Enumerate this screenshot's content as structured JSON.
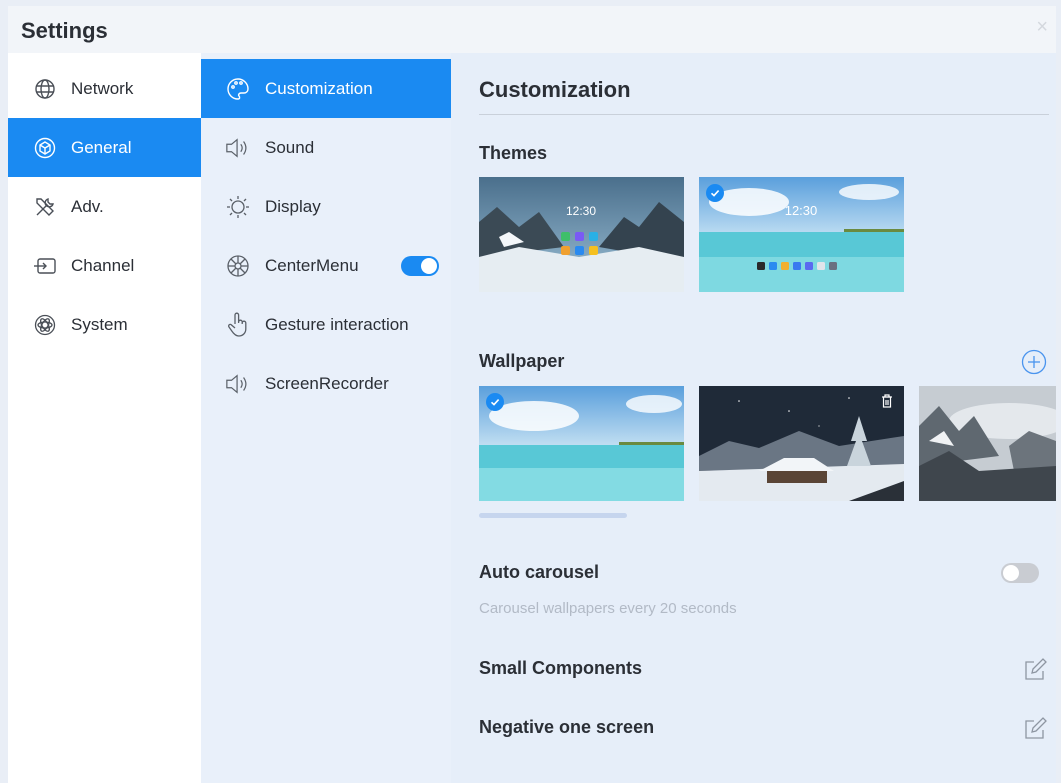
{
  "window": {
    "title": "Settings",
    "close_glyph": "×"
  },
  "nav": {
    "items": [
      {
        "label": "Network",
        "icon": "globe-icon"
      },
      {
        "label": "General",
        "icon": "cube-icon",
        "active": true
      },
      {
        "label": "Adv.",
        "icon": "tools-icon"
      },
      {
        "label": "Channel",
        "icon": "input-icon"
      },
      {
        "label": "System",
        "icon": "atom-icon"
      }
    ]
  },
  "subnav": {
    "items": [
      {
        "label": "Customization",
        "icon": "palette-icon",
        "active": true
      },
      {
        "label": "Sound",
        "icon": "speaker-icon"
      },
      {
        "label": "Display",
        "icon": "sun-icon"
      },
      {
        "label": "CenterMenu",
        "icon": "centermenu-icon",
        "toggle": "on"
      },
      {
        "label": "Gesture interaction",
        "icon": "hand-icon"
      },
      {
        "label": "ScreenRecorder",
        "icon": "speaker-icon"
      }
    ]
  },
  "main": {
    "title": "Customization",
    "themes": {
      "heading": "Themes",
      "items": [
        {
          "name": "mountain-theme",
          "time": "12:30",
          "selected": false
        },
        {
          "name": "beach-theme",
          "time": "12:30",
          "selected": true
        }
      ]
    },
    "wallpaper": {
      "heading": "Wallpaper",
      "items": [
        {
          "name": "beach-wallpaper",
          "selected": true
        },
        {
          "name": "snowy-cabin-wallpaper",
          "deletable": true
        },
        {
          "name": "misty-mountains-wallpaper"
        }
      ]
    },
    "auto_carousel": {
      "label": "Auto carousel",
      "description": "Carousel wallpapers every 20 seconds",
      "enabled": false
    },
    "small_components": {
      "label": "Small Components"
    },
    "negative_one_screen": {
      "label": "Negative one screen"
    }
  },
  "colors": {
    "accent": "#1a8af2",
    "panel_bg": "#e6eef9",
    "subnav_bg": "#e9f0fa"
  }
}
